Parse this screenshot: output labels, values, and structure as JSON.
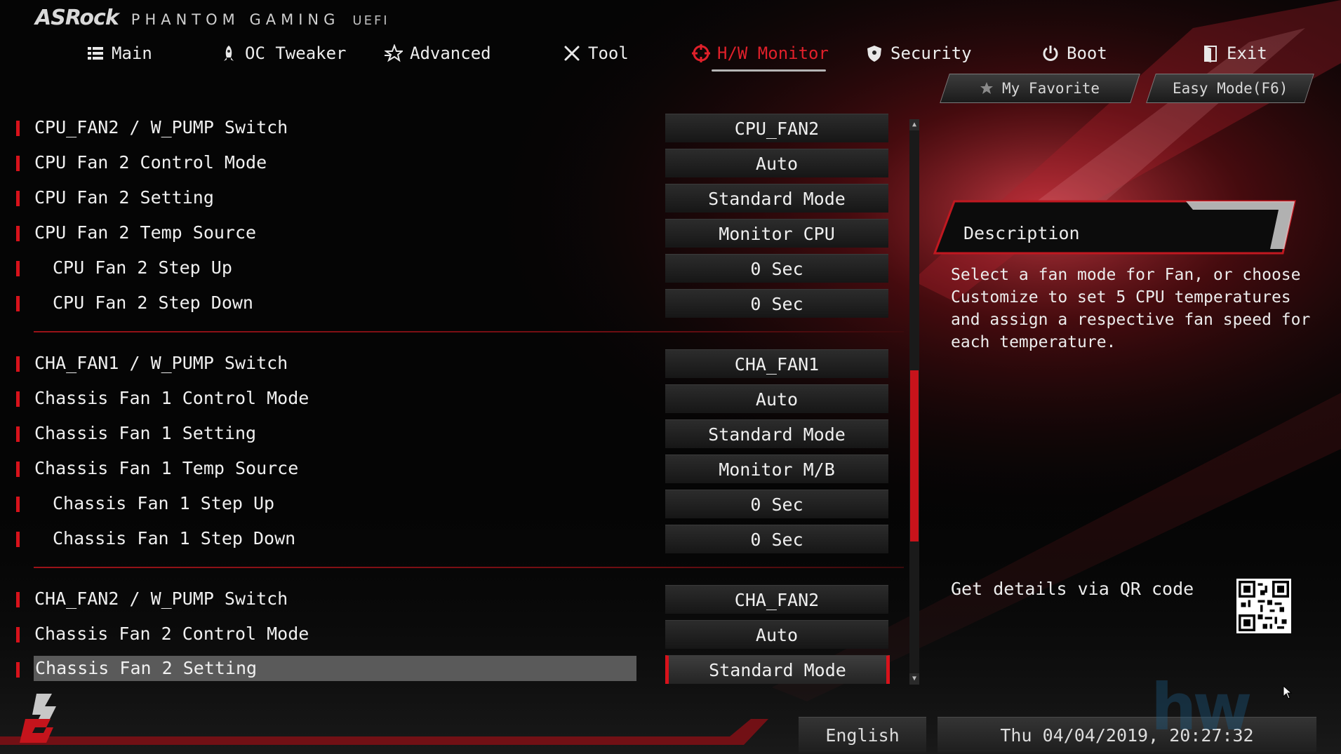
{
  "brand": {
    "logo": "ASRock",
    "product": "PHANTOM GAMING",
    "suffix": "UEFI"
  },
  "tabs": [
    {
      "label": "Main",
      "icon": "list-icon",
      "active": false
    },
    {
      "label": "OC Tweaker",
      "icon": "rocket-icon",
      "active": false
    },
    {
      "label": "Advanced",
      "icon": "star-icon",
      "active": false
    },
    {
      "label": "Tool",
      "icon": "tools-icon",
      "active": false
    },
    {
      "label": "H/W Monitor",
      "icon": "monitor-target-icon",
      "active": true
    },
    {
      "label": "Security",
      "icon": "shield-icon",
      "active": false
    },
    {
      "label": "Boot",
      "icon": "power-icon",
      "active": false
    },
    {
      "label": "Exit",
      "icon": "exit-door-icon",
      "active": false
    }
  ],
  "buttons": {
    "favorite": "My Favorite",
    "easy_mode": "Easy Mode(F6)"
  },
  "settings": [
    {
      "label": "CPU_FAN2 / W_PUMP Switch",
      "value": "CPU_FAN2"
    },
    {
      "label": "CPU Fan 2 Control Mode",
      "value": "Auto"
    },
    {
      "label": "CPU Fan 2 Setting",
      "value": "Standard Mode"
    },
    {
      "label": "CPU Fan 2 Temp Source",
      "value": "Monitor CPU"
    },
    {
      "label": "CPU Fan 2 Step Up",
      "value": "0 Sec"
    },
    {
      "label": "CPU Fan 2 Step Down",
      "value": "0 Sec"
    },
    {
      "label": "CHA_FAN1 / W_PUMP Switch",
      "value": "CHA_FAN1"
    },
    {
      "label": "Chassis Fan 1 Control Mode",
      "value": "Auto"
    },
    {
      "label": "Chassis Fan 1 Setting",
      "value": "Standard Mode"
    },
    {
      "label": "Chassis Fan 1 Temp Source",
      "value": "Monitor M/B"
    },
    {
      "label": "Chassis Fan 1 Step Up",
      "value": "0 Sec"
    },
    {
      "label": "Chassis Fan 1 Step Down",
      "value": "0 Sec"
    },
    {
      "label": "CHA_FAN2 / W_PUMP Switch",
      "value": "CHA_FAN2"
    },
    {
      "label": "Chassis Fan 2 Control Mode",
      "value": "Auto"
    },
    {
      "label": "Chassis Fan 2 Setting",
      "value": "Standard Mode"
    }
  ],
  "description": {
    "title": "Description",
    "text": "Select a fan mode for Fan, or choose Customize to set 5 CPU temperatures and assign a respective fan speed for each temperature.",
    "qr_label": "Get details via QR code"
  },
  "footer": {
    "language": "English",
    "datetime": "Thu 04/04/2019, 20:27:32"
  },
  "colors": {
    "accent": "#d8121b",
    "background": "#050505",
    "highlight": "#5a5a5a"
  }
}
